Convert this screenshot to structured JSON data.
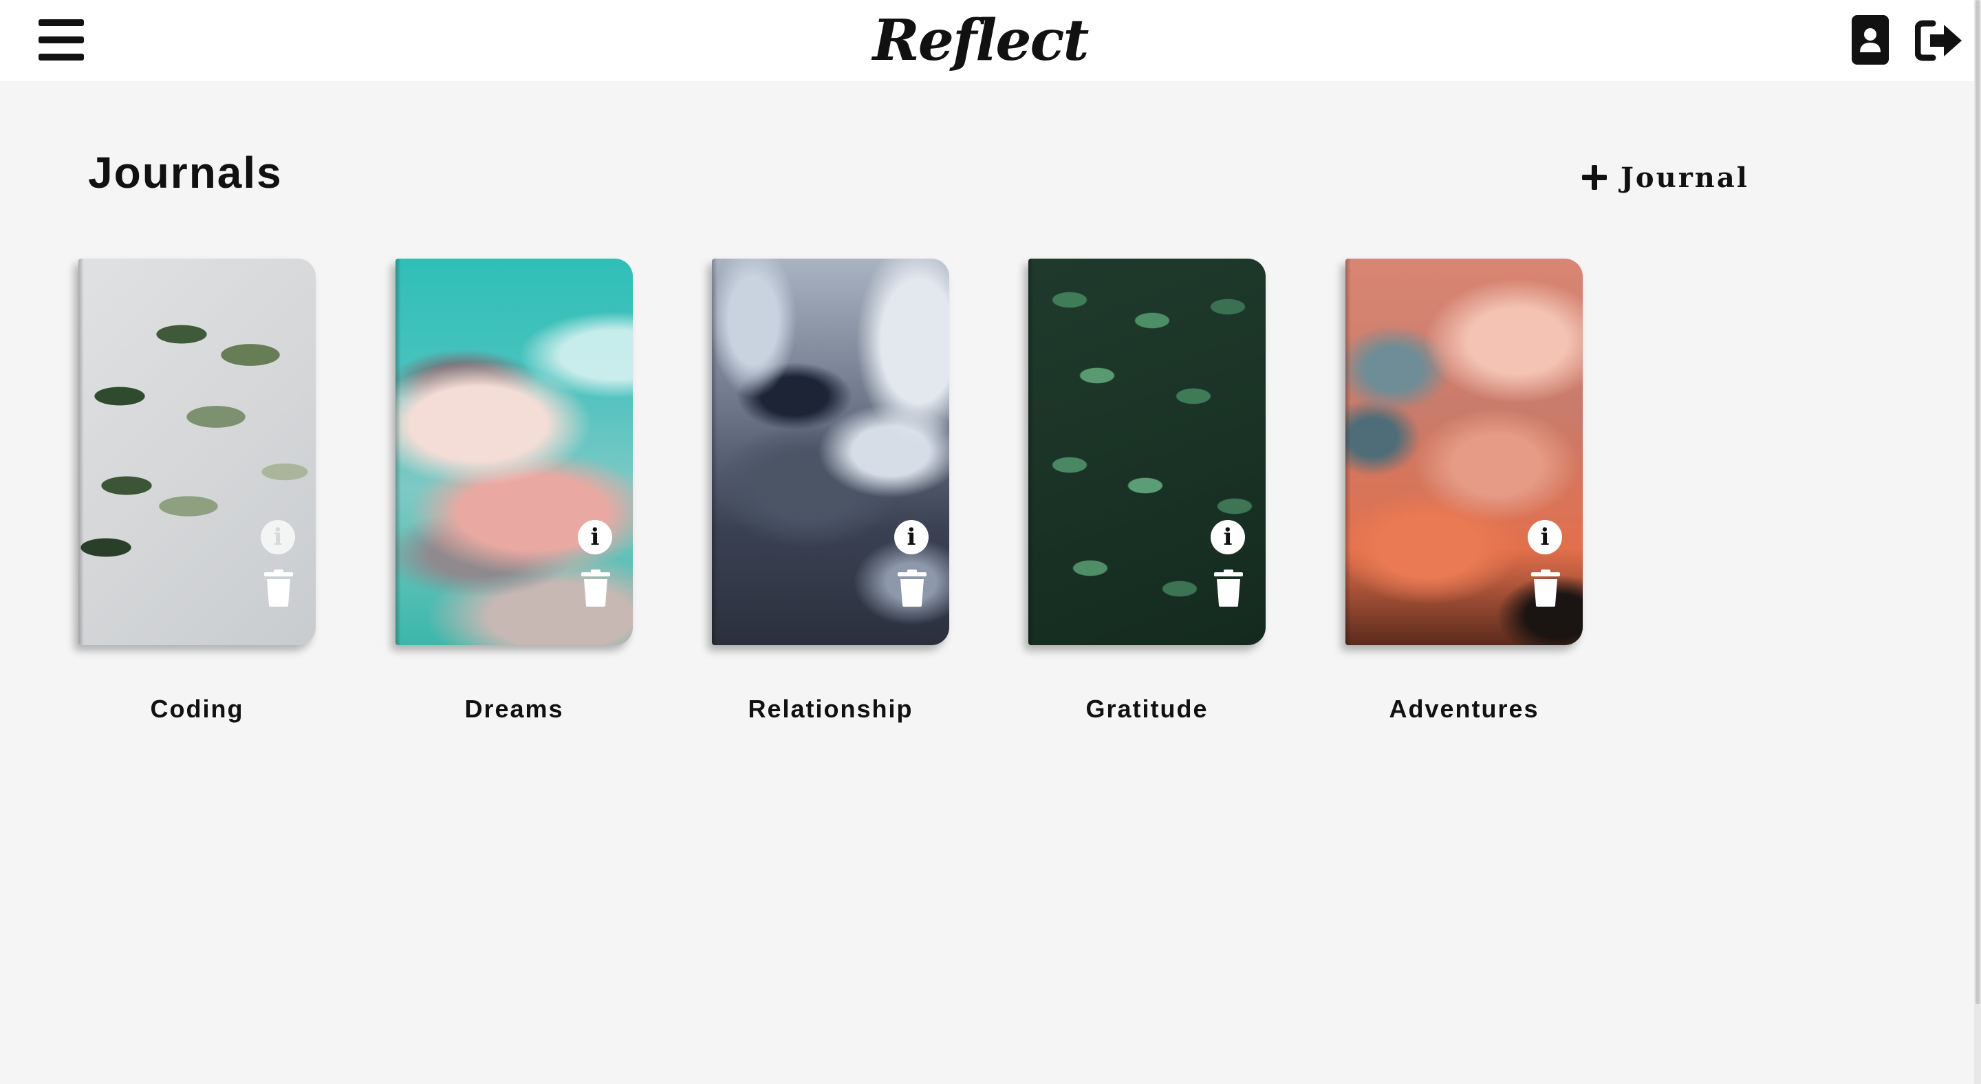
{
  "header": {
    "brand": "Reflect",
    "menu_icon": "hamburger-menu-icon",
    "profile_icon": "user-profile-icon",
    "logout_icon": "sign-out-icon"
  },
  "main": {
    "title": "Journals",
    "add_button": {
      "icon": "plus-icon",
      "label": "Journal"
    }
  },
  "journals": [
    {
      "name": "Coding",
      "cover": "plant-leaves",
      "info_icon": "info-icon",
      "delete_icon": "trash-icon"
    },
    {
      "name": "Dreams",
      "cover": "pastel-clouds",
      "info_icon": "info-icon",
      "delete_icon": "trash-icon"
    },
    {
      "name": "Relationship",
      "cover": "blue-marble",
      "info_icon": "info-icon",
      "delete_icon": "trash-icon"
    },
    {
      "name": "Gratitude",
      "cover": "green-foliage",
      "info_icon": "info-icon",
      "delete_icon": "trash-icon"
    },
    {
      "name": "Adventures",
      "cover": "orange-clouds",
      "info_icon": "info-icon",
      "delete_icon": "trash-icon"
    }
  ],
  "colors": {
    "background": "#f5f5f5",
    "header": "#ffffff",
    "text": "#111111"
  }
}
